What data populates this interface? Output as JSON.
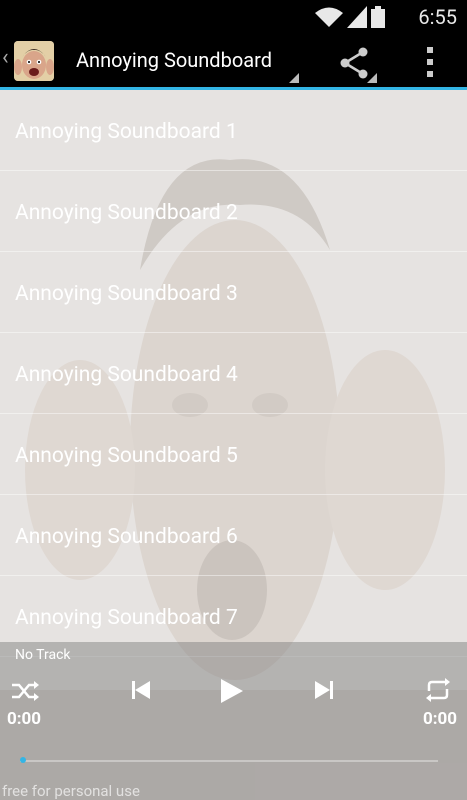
{
  "status_bar": {
    "time": "6:55"
  },
  "action_bar": {
    "title": "Annoying Soundboard",
    "accent_color": "#33b5e5",
    "icons": [
      "back-chevron-icon",
      "app-icon",
      "share-icon",
      "overflow-menu-icon"
    ]
  },
  "list": {
    "items": [
      "Annoying Soundboard 1",
      "Annoying Soundboard 2",
      "Annoying Soundboard 3",
      "Annoying Soundboard 4",
      "Annoying Soundboard 5",
      "Annoying Soundboard 6",
      "Annoying Soundboard 7"
    ]
  },
  "player": {
    "track": "No Track",
    "elapsed": "0:00",
    "duration": "0:00",
    "progress": 0,
    "icons": [
      "shuffle-icon",
      "previous-icon",
      "play-icon",
      "next-icon",
      "repeat-icon"
    ]
  },
  "watermark": "free for personal use"
}
